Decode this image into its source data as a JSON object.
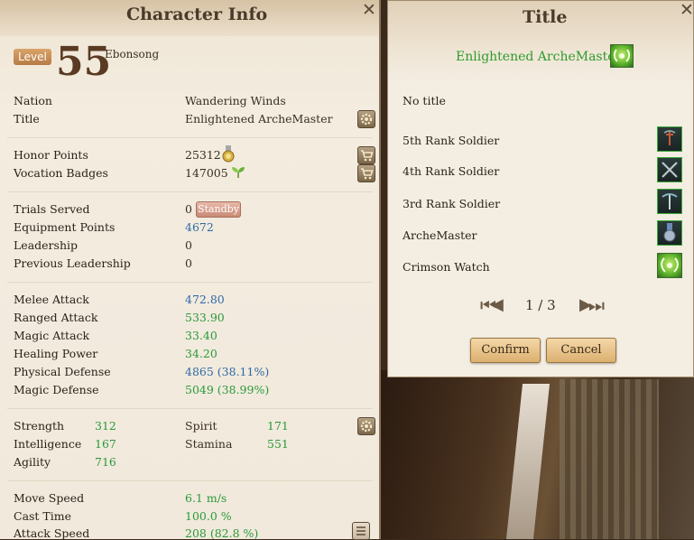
{
  "character_panel": {
    "title": "Character Info",
    "level_label": "Level",
    "level": "55",
    "name": "Ebonsong",
    "info": [
      {
        "label": "Nation",
        "value": "Wandering Winds"
      },
      {
        "label": "Title",
        "value": "Enlightened ArcheMaster"
      }
    ],
    "currency": [
      {
        "label": "Honor Points",
        "value": "25312"
      },
      {
        "label": "Vocation Badges",
        "value": "147005"
      }
    ],
    "trials": [
      {
        "label": "Trials Served",
        "value": "0"
      },
      {
        "label": "Equipment Points",
        "value": "4672"
      },
      {
        "label": "Leadership",
        "value": "0"
      },
      {
        "label": "Previous Leadership",
        "value": "0"
      }
    ],
    "standby_label": "Standby",
    "combat": [
      {
        "label": "Melee Attack",
        "value": "472.80",
        "color": "blue"
      },
      {
        "label": "Ranged Attack",
        "value": "533.90",
        "color": "green"
      },
      {
        "label": "Magic Attack",
        "value": "33.40",
        "color": "green"
      },
      {
        "label": "Healing Power",
        "value": "34.20",
        "color": "green"
      },
      {
        "label": "Physical Defense",
        "value": "4865 (38.11%)",
        "color": "blue"
      },
      {
        "label": "Magic Defense",
        "value": "5049 (38.99%)",
        "color": "green"
      }
    ],
    "attributes": {
      "strength_label": "Strength",
      "strength": "312",
      "spirit_label": "Spirit",
      "spirit": "171",
      "intelligence_label": "Intelligence",
      "intelligence": "167",
      "stamina_label": "Stamina",
      "stamina": "551",
      "agility_label": "Agility",
      "agility": "716"
    },
    "speed": [
      {
        "label": "Move Speed",
        "value": "6.1 m/s"
      },
      {
        "label": "Cast Time",
        "value": "100.0 %"
      },
      {
        "label": "Attack Speed",
        "value": "208 (82.8 %)"
      }
    ]
  },
  "title_panel": {
    "title": "Title",
    "current_title": "Enlightened ArcheMaster",
    "no_title": "No title",
    "titles": [
      {
        "label": "5th Rank Soldier",
        "icon": "sword-rank-icon"
      },
      {
        "label": "4th Rank Soldier",
        "icon": "crossed-swords-icon"
      },
      {
        "label": "3rd Rank Soldier",
        "icon": "bow-rank-icon"
      },
      {
        "label": "ArcheMaster",
        "icon": "medal-icon"
      },
      {
        "label": "Crimson Watch",
        "icon": "laurel-icon"
      }
    ],
    "page": "1 / 3",
    "confirm_label": "Confirm",
    "cancel_label": "Cancel"
  },
  "colors": {
    "blue_value": "#2f6aa6",
    "green_value": "#2a9a3a",
    "title_green": "#2f9a2e"
  }
}
